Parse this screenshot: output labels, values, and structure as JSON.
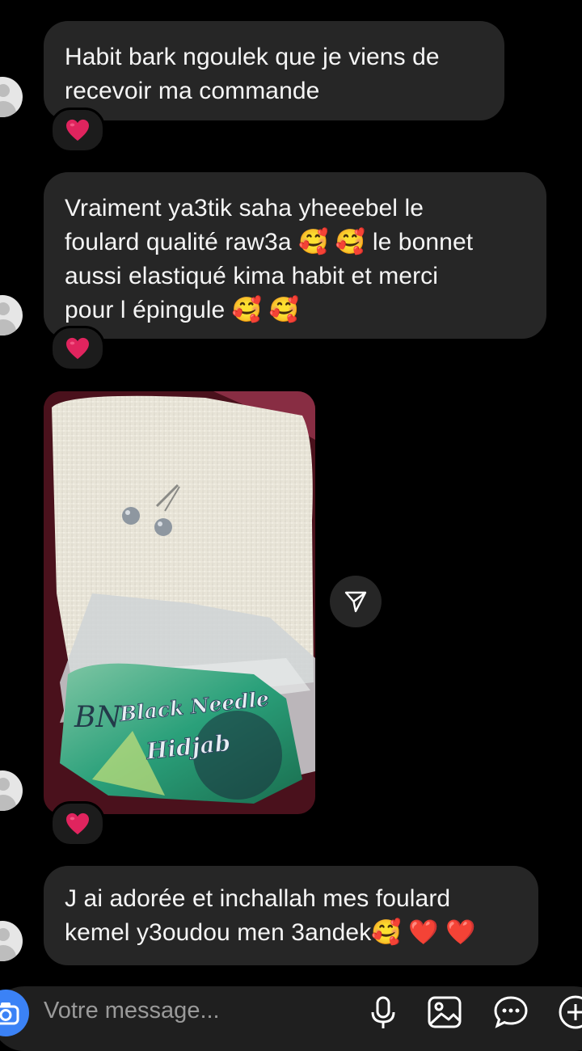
{
  "messages": [
    {
      "text": "Habit bark ngoulek que je viens de recevoir ma commande",
      "reaction": "red-heart"
    },
    {
      "line1": "Vraiment ya3tik saha yheeebel le",
      "line2": "foulard qualité raw3a 🥰 🥰 le bonnet",
      "line3": "aussi elastiqué kima habit et merci",
      "line4": "pour l épingule 🥰 🥰",
      "reaction": "red-heart"
    },
    {
      "photo_label_line1": "Black Needle",
      "photo_label_line2": "Hidjab",
      "photo_logo": "BN",
      "reaction": "red-heart"
    },
    {
      "line1": "J ai adorée et inchallah mes foulard",
      "line2": "kemel y3oudou men 3andek🥰 ❤️ ❤️"
    }
  ],
  "composer": {
    "placeholder": "Votre message..."
  },
  "colors": {
    "background": "#000000",
    "bubble": "#262626",
    "heart": "#e0245e",
    "accent": "#3b82f6"
  },
  "icons": [
    "camera-icon",
    "share-icon",
    "microphone-icon",
    "gallery-icon",
    "sticker-icon",
    "plus-icon",
    "heart-icon",
    "avatar-icon"
  ]
}
